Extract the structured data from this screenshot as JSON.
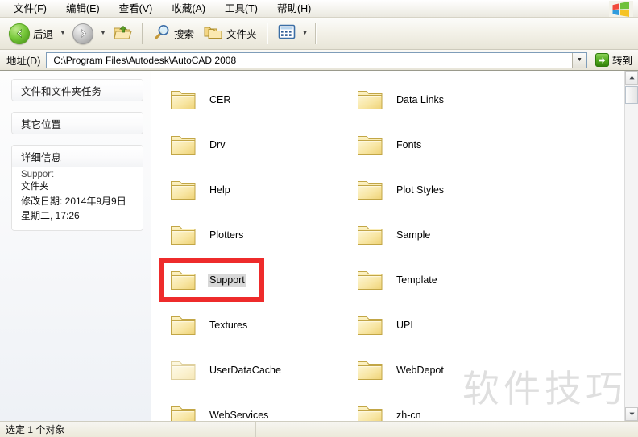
{
  "window": {
    "logo_icon": "windows-flag-icon"
  },
  "menubar": {
    "items": [
      {
        "label": "文件(F)",
        "name": "menu-file"
      },
      {
        "label": "编辑(E)",
        "name": "menu-edit"
      },
      {
        "label": "查看(V)",
        "name": "menu-view"
      },
      {
        "label": "收藏(A)",
        "name": "menu-favorites"
      },
      {
        "label": "工具(T)",
        "name": "menu-tools"
      },
      {
        "label": "帮助(H)",
        "name": "menu-help"
      }
    ]
  },
  "toolbar": {
    "back_label": "后退",
    "back_icon": "back-arrow-icon",
    "forward_icon": "forward-arrow-icon",
    "up_icon": "up-folder-icon",
    "search_label": "搜索",
    "search_icon": "magnifier-icon",
    "folders_label": "文件夹",
    "folders_icon": "folders-icon",
    "views_icon": "views-icon",
    "dropdown_icon": "chevron-down-icon"
  },
  "address": {
    "label": "地址(D)",
    "value": "C:\\Program Files\\Autodesk\\AutoCAD 2008",
    "placeholder": "",
    "dropdown_icon": "chevron-down-icon",
    "go_label": "转到",
    "go_icon": "go-arrow-icon"
  },
  "sidebar": {
    "panels": [
      {
        "title": "文件和文件夹任务",
        "name": "panel-file-folder-tasks"
      },
      {
        "title": "其它位置",
        "name": "panel-other-places"
      }
    ],
    "details": {
      "title": "详细信息",
      "item_name": "Support",
      "item_type": "文件夹",
      "modified_line1": "修改日期: 2014年9月9日",
      "modified_line2": "星期二, 17:26"
    }
  },
  "files": {
    "items": [
      {
        "name": "CER",
        "dim": false,
        "selected": false
      },
      {
        "name": "Data Links",
        "dim": false,
        "selected": false
      },
      {
        "name": "Drv",
        "dim": false,
        "selected": false
      },
      {
        "name": "Fonts",
        "dim": false,
        "selected": false
      },
      {
        "name": "Help",
        "dim": false,
        "selected": false
      },
      {
        "name": "Plot Styles",
        "dim": false,
        "selected": false
      },
      {
        "name": "Plotters",
        "dim": false,
        "selected": false
      },
      {
        "name": "Sample",
        "dim": false,
        "selected": false
      },
      {
        "name": "Support",
        "dim": false,
        "selected": true
      },
      {
        "name": "Template",
        "dim": false,
        "selected": false
      },
      {
        "name": "Textures",
        "dim": false,
        "selected": false
      },
      {
        "name": "UPI",
        "dim": false,
        "selected": false
      },
      {
        "name": "UserDataCache",
        "dim": true,
        "selected": false
      },
      {
        "name": "WebDepot",
        "dim": false,
        "selected": false
      },
      {
        "name": "WebServices",
        "dim": false,
        "selected": false
      },
      {
        "name": "zh-cn",
        "dim": false,
        "selected": false
      }
    ]
  },
  "highlight": {
    "target": "Support",
    "color": "#ee2b2b"
  },
  "watermark": {
    "text": "软件技巧"
  },
  "statusbar": {
    "text": "选定 1 个对象"
  }
}
